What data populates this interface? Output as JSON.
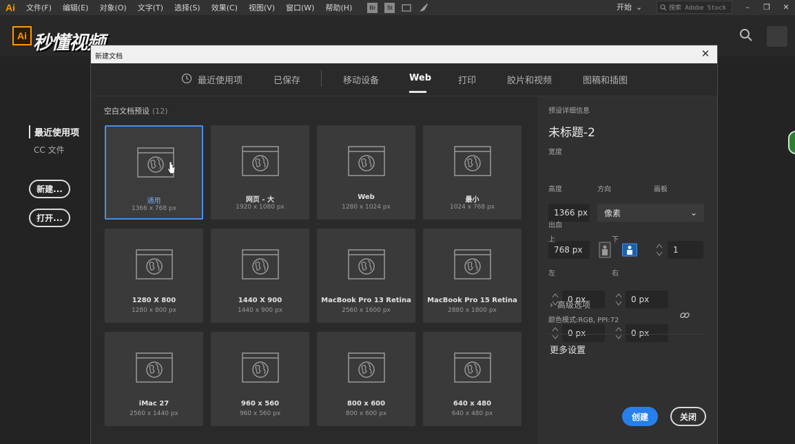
{
  "app": {
    "logo": "Ai",
    "menu": [
      "文件(F)",
      "编辑(E)",
      "对象(O)",
      "文字(T)",
      "选择(S)",
      "效果(C)",
      "视图(V)",
      "窗口(W)",
      "帮助(H)"
    ],
    "bridge": "Br",
    "stock": "St",
    "workspace": "开始",
    "search_placeholder": "搜索 Adobe Stock"
  },
  "watermark": {
    "logo": "Ai",
    "text": "秒懂视频"
  },
  "start_panel": {
    "recent": "最近使用项",
    "cc_files": "CC 文件",
    "new_button": "新建...",
    "open_button": "打开..."
  },
  "dialog": {
    "title": "新建文档",
    "tabs": [
      {
        "label": "最近使用项",
        "icon": "clock-icon"
      },
      {
        "label": "已保存"
      },
      {
        "label": "移动设备"
      },
      {
        "label": "Web",
        "active": true
      },
      {
        "label": "打印"
      },
      {
        "label": "胶片和视频"
      },
      {
        "label": "图稿和插图"
      }
    ],
    "presets_label": "空白文档预设",
    "presets_count": "(12)",
    "presets": [
      {
        "name": "通用",
        "size": "1366 x 768 px",
        "selected": true
      },
      {
        "name": "网页 - 大",
        "size": "1920 x 1080 px"
      },
      {
        "name": "Web",
        "size": "1280 x 1024 px"
      },
      {
        "name": "最小",
        "size": "1024 x 768 px"
      },
      {
        "name": "1280 X 800",
        "size": "1280 x 800 px"
      },
      {
        "name": "1440 X 900",
        "size": "1440 x 900 px"
      },
      {
        "name": "MacBook Pro 13 Retina",
        "size": "2560 x 1600 px"
      },
      {
        "name": "MacBook Pro 15 Retina",
        "size": "2880 x 1800 px"
      },
      {
        "name": "iMac 27",
        "size": "2560 x 1440 px"
      },
      {
        "name": "960 x 560",
        "size": "960 x 560 px"
      },
      {
        "name": "800 x 600",
        "size": "800 x 600 px"
      },
      {
        "name": "640 x 480",
        "size": "640 x 480 px"
      }
    ],
    "details": {
      "header": "预设详细信息",
      "doc_name": "未标题-2",
      "width_label": "宽度",
      "width_value": "1366 px",
      "unit": "像素",
      "height_label": "高度",
      "height_value": "768 px",
      "orientation_label": "方向",
      "artboards_label": "画板",
      "artboards_value": "1",
      "bleed_label": "出血",
      "top_label": "上",
      "top_value": "0 px",
      "bottom_label": "下",
      "bottom_value": "0 px",
      "left_label": "左",
      "left_value": "0 px",
      "right_label": "右",
      "right_value": "0 px",
      "advanced": "高级选项",
      "color_mode": "颜色模式:RGB, PPI:72",
      "more_settings": "更多设置",
      "create_button": "创建",
      "close_button": "关闭"
    }
  },
  "colors": {
    "accent": "#2680eb",
    "selected_border": "#4a8fe7",
    "ai_orange": "#ff9a00"
  }
}
